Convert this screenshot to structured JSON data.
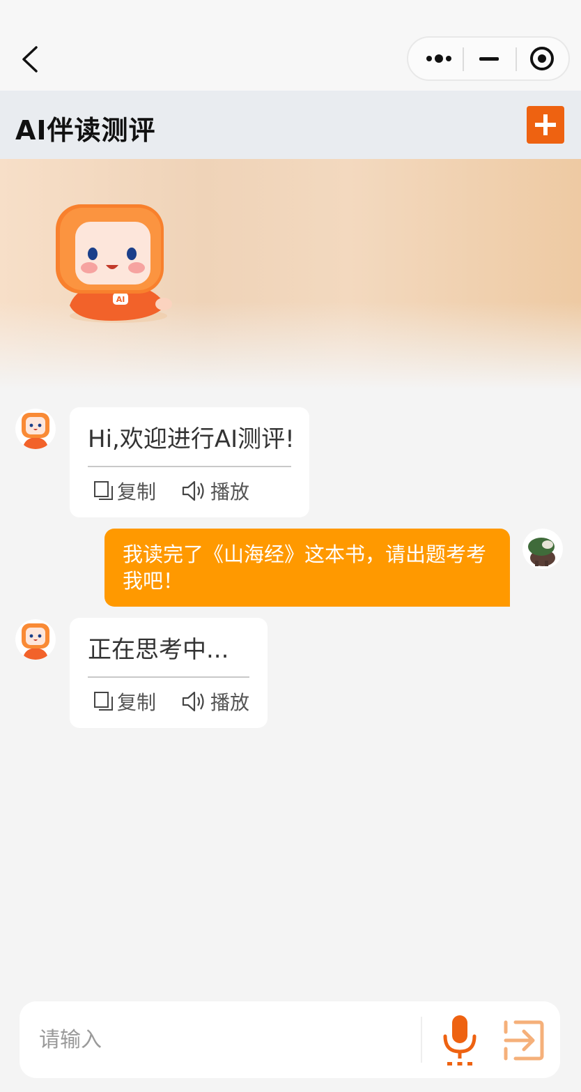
{
  "header": {
    "title": "AI伴读测评"
  },
  "colors": {
    "accent": "#ee6211",
    "user_bubble": "#ff9900",
    "send_icon": "#f5b07a"
  },
  "messages": [
    {
      "role": "ai",
      "text": "Hi,欢迎进行AI测评!",
      "actions": {
        "copy": "复制",
        "play": "播放"
      }
    },
    {
      "role": "user",
      "text": "我读完了《山海经》这本书，请出题考考我吧！"
    },
    {
      "role": "ai",
      "text": "正在思考中...",
      "actions": {
        "copy": "复制",
        "play": "播放"
      }
    }
  ],
  "input": {
    "placeholder": "请输入"
  },
  "icons": {
    "back": "chevron-left-icon",
    "more": "more-dots-icon",
    "minimize": "minus-icon",
    "close": "target-icon",
    "add": "plus-icon",
    "copy": "copy-icon",
    "play": "speaker-icon",
    "mic": "microphone-icon",
    "send": "send-icon"
  }
}
